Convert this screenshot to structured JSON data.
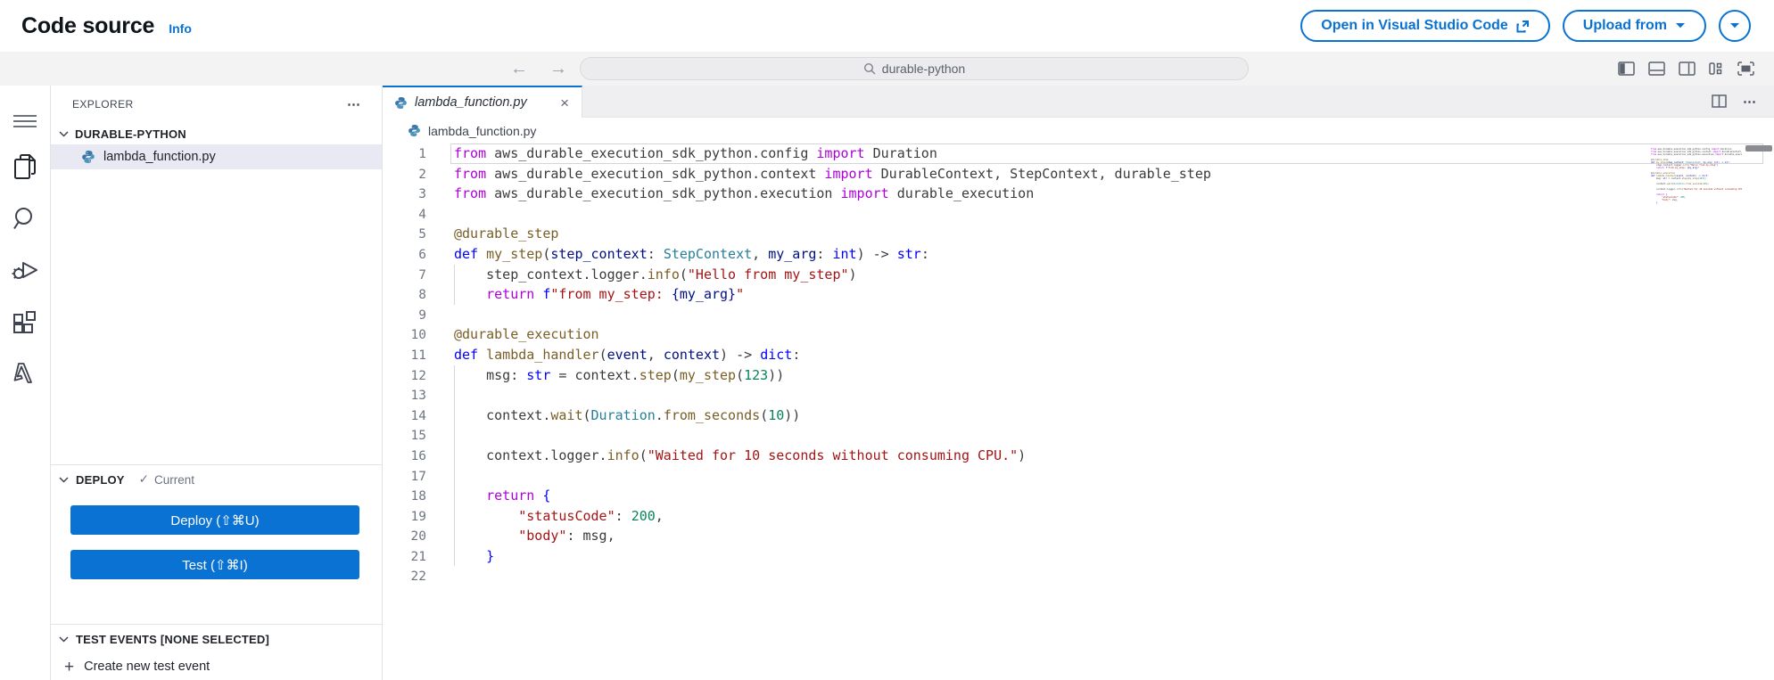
{
  "colors": {
    "accent": "#0972d3",
    "selected_row_bg": "#e9e9f3",
    "toolbar_bg": "#f3f3f4",
    "header_text": "#0f141a"
  },
  "page": {
    "title": "Code source",
    "info_link": "Info"
  },
  "header_actions": {
    "open_vscode_label": "Open in Visual Studio Code",
    "upload_from_label": "Upload from"
  },
  "toolbar": {
    "search_value": "durable-python"
  },
  "activity_bar": {
    "icons": [
      "menu-icon",
      "files-icon",
      "search-icon",
      "run-debug-icon",
      "extensions-icon",
      "aws-lambda-icon"
    ]
  },
  "explorer": {
    "title": "EXPLORER",
    "folder": "DURABLE-PYTHON",
    "file": {
      "name": "lambda_function.py"
    },
    "deploy": {
      "label": "DEPLOY",
      "status_check": "✓",
      "status": "Current",
      "deploy_button": "Deploy (⇧⌘U)",
      "test_button": "Test (⇧⌘I)"
    },
    "test_events": {
      "label": "TEST EVENTS [NONE SELECTED]",
      "create_label": "Create new test event"
    }
  },
  "editor": {
    "tab_label": "lambda_function.py",
    "tab_close": "×",
    "breadcrumb": "lambda_function.py",
    "syntax_colors": {
      "k": "#af00db",
      "d": "#0000ff",
      "t": "#267f99",
      "fn": "#795e26",
      "p": "#001080",
      "s": "#a31515",
      "n": "#098658",
      "b": "#3b3b3b"
    },
    "lines": [
      {
        "n": 1,
        "active": true,
        "tokens": [
          [
            "k",
            "from"
          ],
          [
            "b",
            " aws_durable_execution_sdk_python.config "
          ],
          [
            "k",
            "import"
          ],
          [
            "b",
            " Duration"
          ]
        ]
      },
      {
        "n": 2,
        "tokens": [
          [
            "k",
            "from"
          ],
          [
            "b",
            " aws_durable_execution_sdk_python.context "
          ],
          [
            "k",
            "import"
          ],
          [
            "b",
            " DurableContext, StepContext, durable_step"
          ]
        ]
      },
      {
        "n": 3,
        "tokens": [
          [
            "k",
            "from"
          ],
          [
            "b",
            " aws_durable_execution_sdk_python.execution "
          ],
          [
            "k",
            "import"
          ],
          [
            "b",
            " durable_execution"
          ]
        ]
      },
      {
        "n": 4,
        "tokens": []
      },
      {
        "n": 5,
        "tokens": [
          [
            "fn",
            "@durable_step"
          ]
        ]
      },
      {
        "n": 6,
        "tokens": [
          [
            "d",
            "def"
          ],
          [
            "b",
            " "
          ],
          [
            "fn",
            "my_step"
          ],
          [
            "b",
            "("
          ],
          [
            "p",
            "step_context"
          ],
          [
            "b",
            ": "
          ],
          [
            "t",
            "StepContext"
          ],
          [
            "b",
            ", "
          ],
          [
            "p",
            "my_arg"
          ],
          [
            "b",
            ": "
          ],
          [
            "d",
            "int"
          ],
          [
            "b",
            ") -> "
          ],
          [
            "d",
            "str"
          ],
          [
            "b",
            ":"
          ]
        ]
      },
      {
        "n": 7,
        "guide": true,
        "tokens": [
          [
            "b",
            "    step_context.logger."
          ],
          [
            "fn",
            "info"
          ],
          [
            "b",
            "("
          ],
          [
            "s",
            "\"Hello from my_step\""
          ],
          [
            "b",
            ")"
          ]
        ]
      },
      {
        "n": 8,
        "guide": true,
        "tokens": [
          [
            "b",
            "    "
          ],
          [
            "k",
            "return"
          ],
          [
            "b",
            " "
          ],
          [
            "d",
            "f"
          ],
          [
            "s",
            "\"from my_step: "
          ],
          [
            "p",
            "{my_arg}"
          ],
          [
            "s",
            "\""
          ]
        ]
      },
      {
        "n": 9,
        "tokens": []
      },
      {
        "n": 10,
        "tokens": [
          [
            "fn",
            "@durable_execution"
          ]
        ]
      },
      {
        "n": 11,
        "tokens": [
          [
            "d",
            "def"
          ],
          [
            "b",
            " "
          ],
          [
            "fn",
            "lambda_handler"
          ],
          [
            "b",
            "("
          ],
          [
            "p",
            "event"
          ],
          [
            "b",
            ", "
          ],
          [
            "p",
            "context"
          ],
          [
            "b",
            ") -> "
          ],
          [
            "d",
            "dict"
          ],
          [
            "b",
            ":"
          ]
        ]
      },
      {
        "n": 12,
        "guide": true,
        "tokens": [
          [
            "b",
            "    msg: "
          ],
          [
            "d",
            "str"
          ],
          [
            "b",
            " = context."
          ],
          [
            "fn",
            "step"
          ],
          [
            "b",
            "("
          ],
          [
            "fn",
            "my_step"
          ],
          [
            "b",
            "("
          ],
          [
            "n",
            "123"
          ],
          [
            "b",
            "))"
          ]
        ]
      },
      {
        "n": 13,
        "guide": true,
        "tokens": []
      },
      {
        "n": 14,
        "guide": true,
        "tokens": [
          [
            "b",
            "    context."
          ],
          [
            "fn",
            "wait"
          ],
          [
            "b",
            "("
          ],
          [
            "t",
            "Duration"
          ],
          [
            "b",
            "."
          ],
          [
            "fn",
            "from_seconds"
          ],
          [
            "b",
            "("
          ],
          [
            "n",
            "10"
          ],
          [
            "b",
            "))"
          ]
        ]
      },
      {
        "n": 15,
        "guide": true,
        "tokens": []
      },
      {
        "n": 16,
        "guide": true,
        "tokens": [
          [
            "b",
            "    context.logger."
          ],
          [
            "fn",
            "info"
          ],
          [
            "b",
            "("
          ],
          [
            "s",
            "\"Waited for 10 seconds without consuming CPU.\""
          ],
          [
            "b",
            ")"
          ]
        ]
      },
      {
        "n": 17,
        "guide": true,
        "tokens": []
      },
      {
        "n": 18,
        "guide": true,
        "tokens": [
          [
            "b",
            "    "
          ],
          [
            "k",
            "return"
          ],
          [
            "b",
            " "
          ],
          [
            "d",
            "{"
          ]
        ]
      },
      {
        "n": 19,
        "guide": true,
        "tokens": [
          [
            "b",
            "        "
          ],
          [
            "s",
            "\"statusCode\""
          ],
          [
            "b",
            ": "
          ],
          [
            "n",
            "200"
          ],
          [
            "b",
            ","
          ]
        ]
      },
      {
        "n": 20,
        "guide": true,
        "tokens": [
          [
            "b",
            "        "
          ],
          [
            "s",
            "\"body\""
          ],
          [
            "b",
            ": msg,"
          ]
        ]
      },
      {
        "n": 21,
        "guide": true,
        "tokens": [
          [
            "b",
            "    "
          ],
          [
            "d",
            "}"
          ]
        ]
      },
      {
        "n": 22,
        "tokens": []
      }
    ]
  }
}
